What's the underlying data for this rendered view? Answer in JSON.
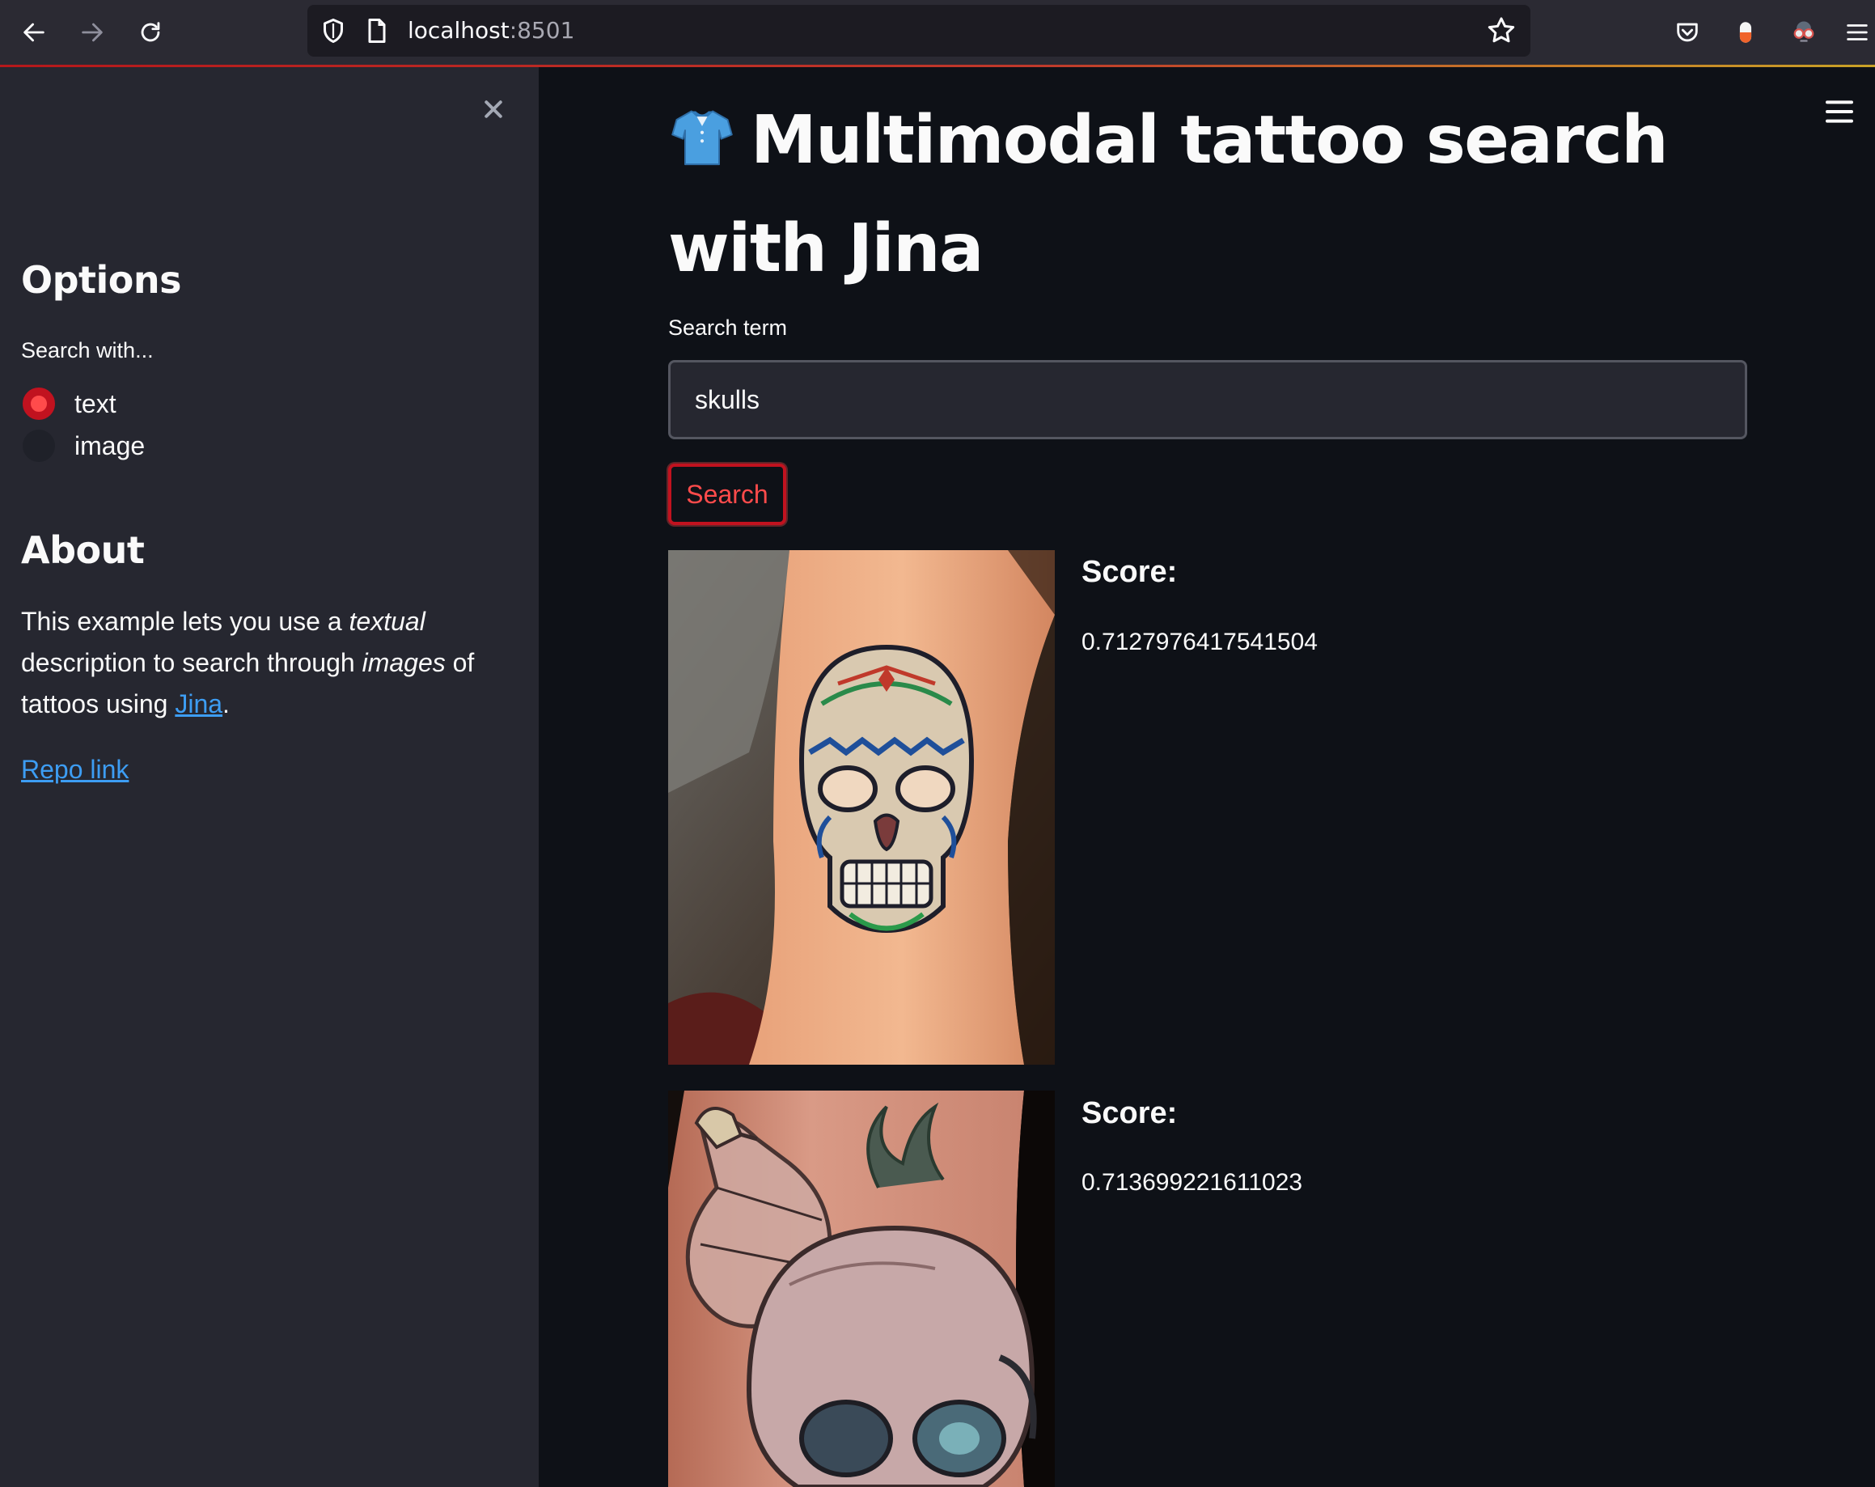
{
  "browser": {
    "url_host": "localhost",
    "url_port": ":8501"
  },
  "sidebar": {
    "options_heading": "Options",
    "search_with_label": "Search with...",
    "radio_options": [
      {
        "label": "text",
        "selected": true
      },
      {
        "label": "image",
        "selected": false
      }
    ],
    "about_heading": "About",
    "about": {
      "part1": "This example lets you use a ",
      "em1": "textual",
      "part2": " description to search through ",
      "em2": "images",
      "part3": " of tattoos using ",
      "link": "Jina",
      "part4": "."
    },
    "repo_link": "Repo link"
  },
  "main": {
    "title": "Multimodal tattoo search with Jina",
    "title_icon": "shirt-emoji",
    "search_label": "Search term",
    "search_value": "skulls",
    "search_button": "Search",
    "results": [
      {
        "score_label": "Score:",
        "score": "0.7127976417541504",
        "image": "sugar-skull-tattoo"
      },
      {
        "score_label": "Score:",
        "score": "0.713699221611023",
        "image": "skull-bottle-tattoo"
      }
    ]
  },
  "colors": {
    "primary": "#ff4b4b",
    "sidebar_bg": "#262730",
    "main_bg": "#0e1117",
    "link": "#3d9df3"
  }
}
